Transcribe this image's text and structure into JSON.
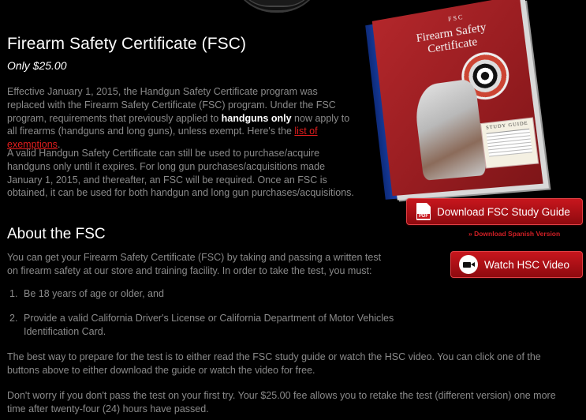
{
  "header": {
    "title": "Firearm Safety Certificate (FSC)",
    "price": "Only $25.00"
  },
  "intro": {
    "p1_part1": "Effective January 1, 2015, the Handgun Safety Certificate program was replaced with the Firearm Safety Certificate (FSC) program. Under the FSC program, requirements that previously applied to ",
    "p1_bold": "handguns only",
    "p1_part2": " now apply to all firearms (handguns and long guns), unless exempt. Here's the ",
    "p1_link": "list of exemptions",
    "p1_end": ".",
    "p2": "A valid Handgun Safety Certificate can still be used to purchase/acquire handguns only until it expires. For long gun purchases/acquisitions made January 1, 2015, and thereafter, an FSC will be required. Once an FSC is obtained, it can be used for both handgun and long gun purchases/acquisitions."
  },
  "about": {
    "heading": "About the FSC",
    "p1": "You can get your Firearm Safety Certificate (FSC) by taking and passing a written test on firearm safety at our store and training facility. In order to take the test, you must:",
    "requirements": [
      {
        "num": "1.",
        "text": "Be 18 years of age or older, and"
      },
      {
        "num": "2.",
        "text": "Provide a valid California Driver's License or California Department of Motor Vehicles Identification Card."
      }
    ],
    "p2": "The best way to prepare for the test is to either read the FSC study guide or watch the HSC video. You can click one of the buttons above to either download the guide or watch the video for free.",
    "p3": "Don't worry if you don't pass the test on your first try. Your $25.00 fee allows you to retake the test (different version) one more time after twenty-four (24) hours have passed."
  },
  "book": {
    "abbr": "FSC",
    "title_line1": "Firearm Safety",
    "title_line2": "Certificate",
    "label": "STUDY GUIDE"
  },
  "actions": {
    "download_label": "Download FSC Study Guide",
    "pdf_badge": "PDF",
    "spanish_label": "» Download Spanish Version",
    "video_label": "Watch HSC Video"
  },
  "colors": {
    "accent": "#c7161d",
    "link": "#e01d1d",
    "background": "#000000"
  }
}
